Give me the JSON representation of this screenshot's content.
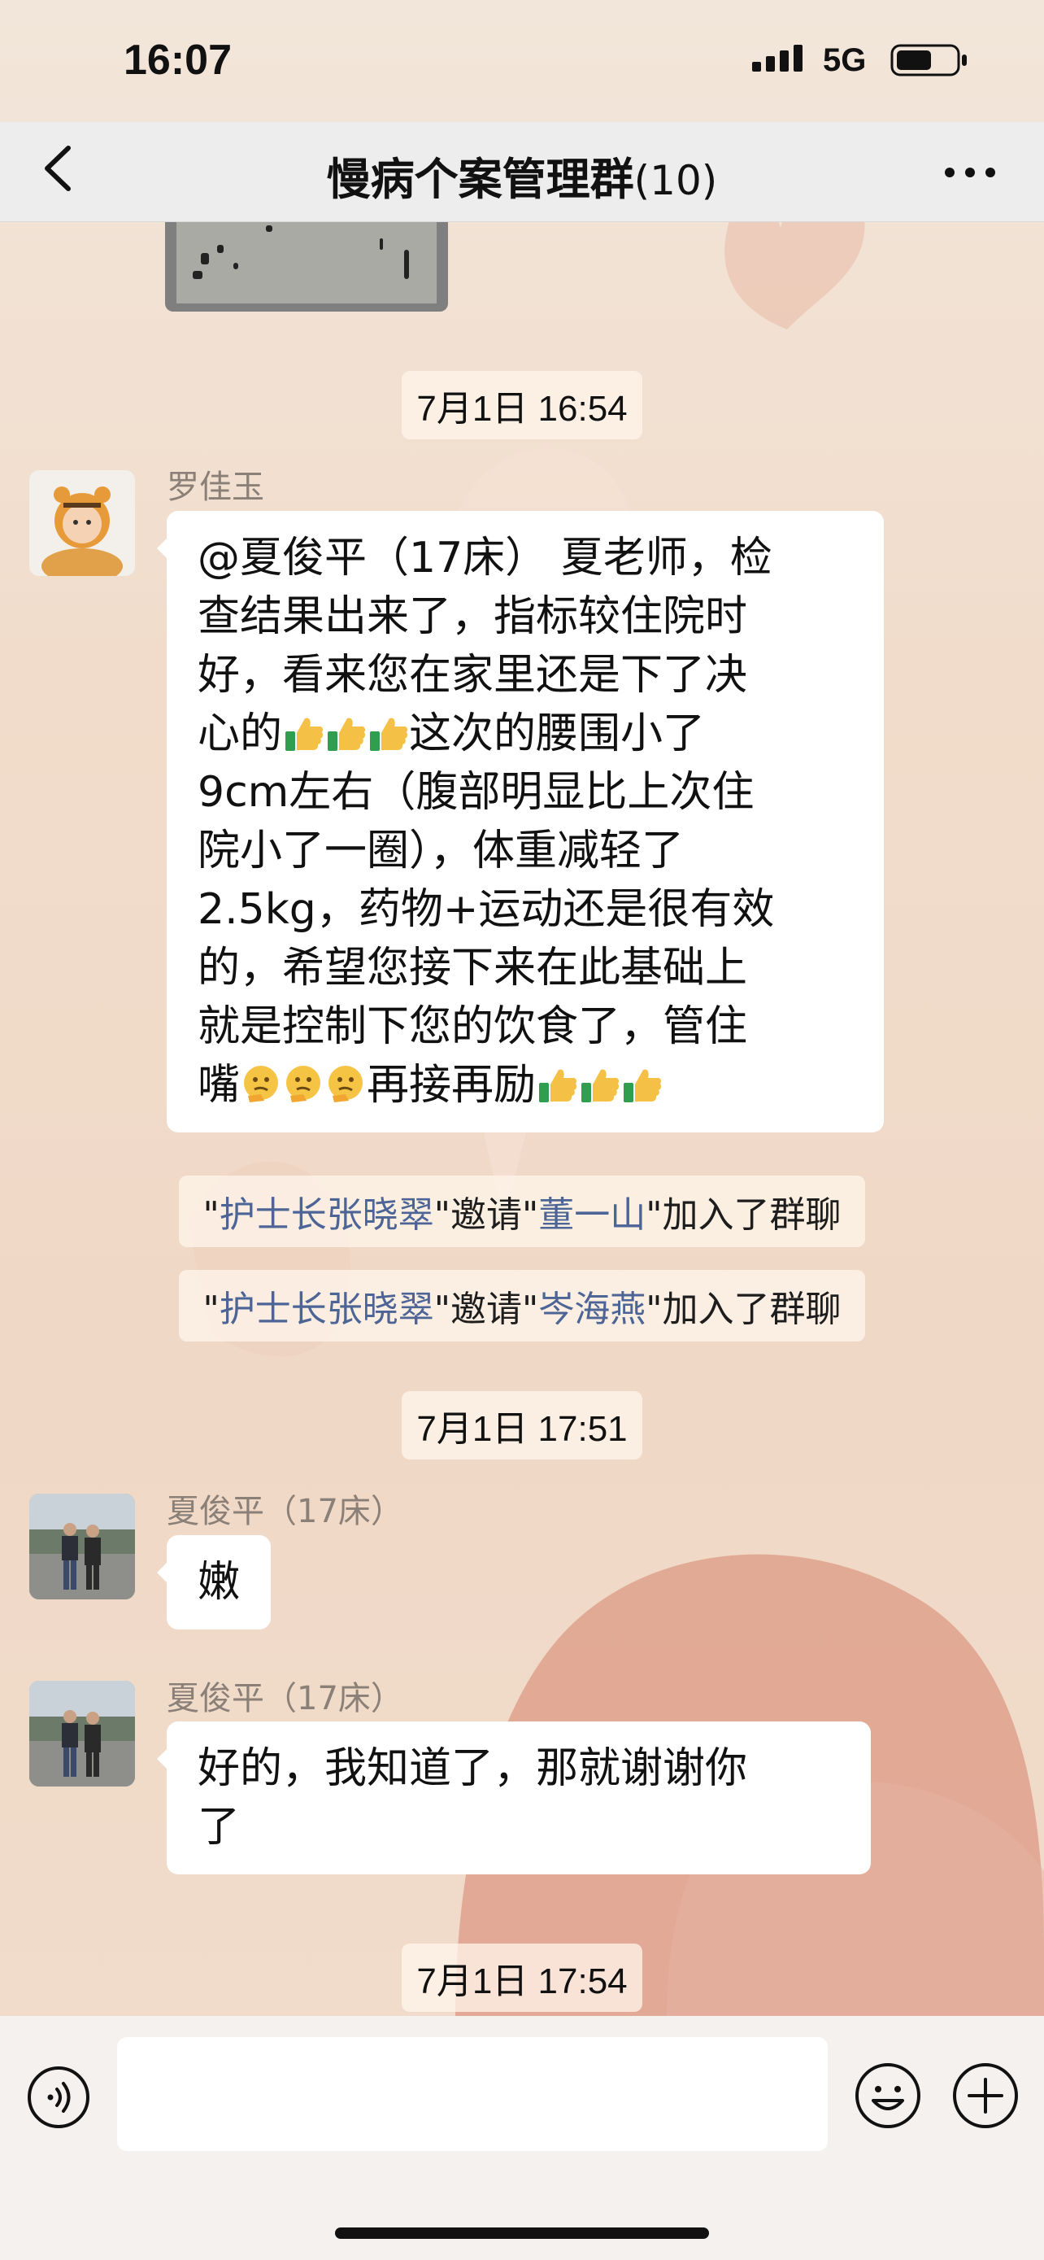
{
  "status_bar": {
    "time": "16:07",
    "network": "5G"
  },
  "nav": {
    "title": "慢病个案管理群",
    "member_count": "(10)"
  },
  "messages": {
    "ts1": "7月1日 16:54",
    "m1_sender": "罗佳玉",
    "m1_lines": [
      "@夏俊平（17床） 夏老师，检",
      "查结果出来了，指标较住院时",
      "好，看来您在家里还是下了决",
      "心的",
      "这次的腰围小了",
      "9cm左右（腹部明显比上次住",
      "院小了一圈），体重减轻了",
      "2.5kg，药物+运动还是很有效",
      "的，希望您接下来在此基础上",
      "就是控制下您的饮食了，管住",
      "嘴",
      "再接再励"
    ],
    "sys1": {
      "q1": "\"",
      "inviter": "护士长张晓翠",
      "q2": "\"邀请\"",
      "invitee": "董一山",
      "q3": "\"加入了群聊"
    },
    "sys2": {
      "q1": "\"",
      "inviter": "护士长张晓翠",
      "q2": "\"邀请\"",
      "invitee": "岑海燕",
      "q3": "\"加入了群聊"
    },
    "ts2": "7月1日 17:51",
    "m2_sender": "夏俊平（17床）",
    "m2_text": "嫩",
    "m3_sender": "夏俊平（17床）",
    "m3_lines": [
      "好的，我知道了，那就谢谢你",
      "了"
    ],
    "ts3": "7月1日 17:54"
  },
  "icons": {
    "thumbs_up": "thumbs-up-emoji",
    "thinking": "thinking-face-emoji",
    "voice": "voice-icon",
    "emoji": "emoji-icon",
    "plus": "plus-icon",
    "back": "chevron-left-icon",
    "more": "more-icon"
  }
}
